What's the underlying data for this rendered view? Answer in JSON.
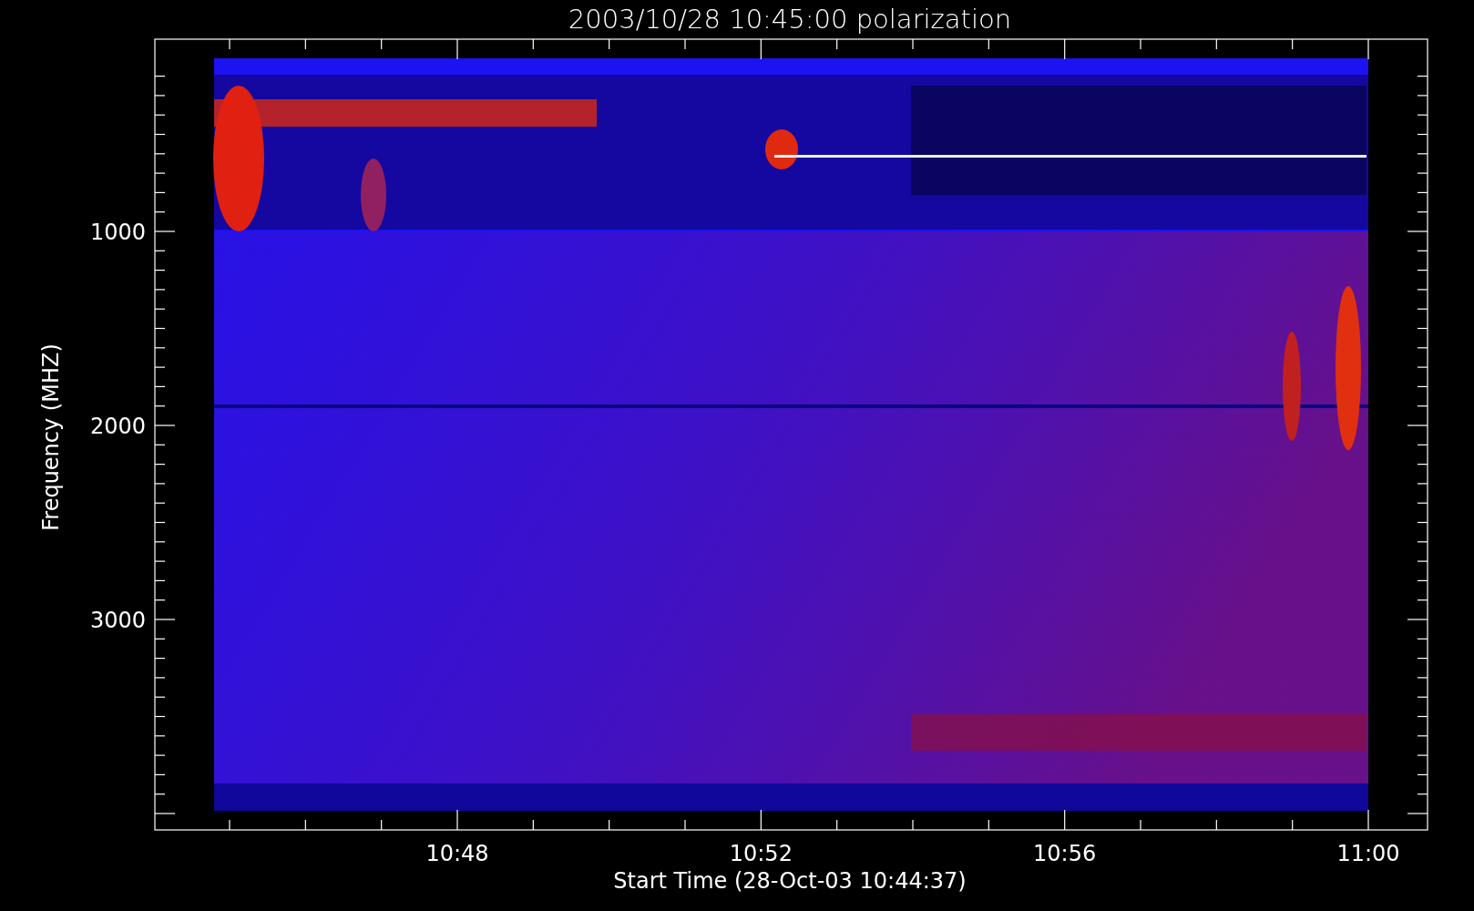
{
  "title": "2003/10/28 10:45:00 polarization",
  "y_axis": {
    "label": "Frequency (MHZ)",
    "ticks": [
      "1000",
      "2000",
      "3000"
    ]
  },
  "x_axis": {
    "label": "Start Time (28-Oct-03 10:44:37)",
    "ticks": [
      "10:48",
      "10:52",
      "10:56",
      "11:00"
    ]
  }
}
